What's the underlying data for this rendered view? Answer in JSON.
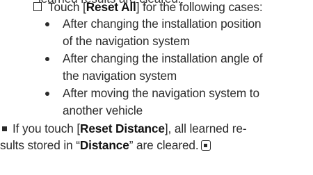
{
  "top_partial": "learned results are cleared.",
  "case_intro": {
    "prefix": "Touch [",
    "button": "Reset All",
    "suffix": "] for the following cases:"
  },
  "bullets": [
    [
      "After changing the installation position",
      "of the navigation system"
    ],
    [
      "After changing the installation angle of",
      "the navigation system"
    ],
    [
      "After moving the navigation system to",
      "another vehicle"
    ]
  ],
  "distance_note": {
    "prefix": "If you touch [",
    "button": "Reset Distance",
    "middle": "], all learned re-",
    "line2_prefix": "sults stored in “",
    "term": "Distance",
    "line2_suffix": "” are cleared."
  },
  "icons": [
    "checkbox-outline-icon",
    "bullet-dot-icon",
    "square-bullet-icon",
    "end-of-section-icon"
  ]
}
